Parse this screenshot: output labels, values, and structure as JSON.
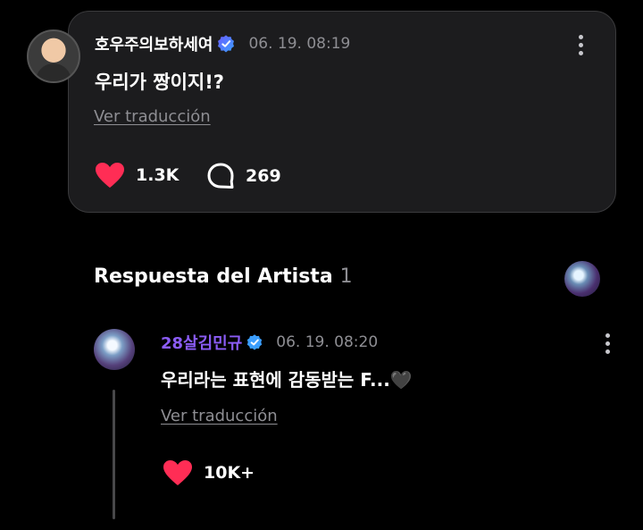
{
  "post": {
    "author": "호우주의보하세여",
    "timestamp": "06. 19. 08:19",
    "text": "우리가 짱이지!?",
    "translate_label": "Ver traducción",
    "likes": "1.3K",
    "comments": "269"
  },
  "artist_section": {
    "title": "Respuesta del Artista",
    "count": "1"
  },
  "reply": {
    "author": "28살김민규",
    "timestamp": "06. 19. 08:20",
    "text": "우리라는 표현에 감동받는 F...🖤",
    "translate_label": "Ver traducción",
    "likes": "10K+"
  },
  "colors": {
    "heart": "#ff2d55",
    "reply_author": "#8b5cf6",
    "verified_badge": "#3b82f6"
  }
}
